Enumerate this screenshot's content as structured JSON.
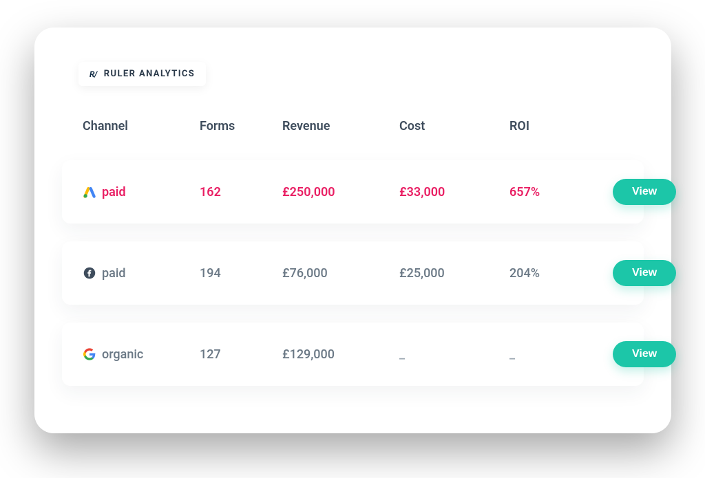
{
  "brand": {
    "mark": "R/",
    "name": "RULER ANALYTICS"
  },
  "headers": {
    "channel": "Channel",
    "forms": "Forms",
    "revenue": "Revenue",
    "cost": "Cost",
    "roi": "ROI"
  },
  "rows": [
    {
      "icon": "google-ads-icon",
      "channel": "paid",
      "forms": "162",
      "revenue": "£250,000",
      "cost": "£33,000",
      "roi": "657%",
      "highlight": true
    },
    {
      "icon": "facebook-icon",
      "channel": "paid",
      "forms": "194",
      "revenue": "£76,000",
      "cost": "£25,000",
      "roi": "204%",
      "highlight": false
    },
    {
      "icon": "google-icon",
      "channel": "organic",
      "forms": "127",
      "revenue": "£129,000",
      "cost": "_",
      "roi": "_",
      "highlight": false
    }
  ],
  "buttons": {
    "view": "View"
  },
  "colors": {
    "accent": "#1cc6a8",
    "highlight": "#e91e63",
    "text_primary": "#3e4c5c",
    "text_secondary": "#6a7885"
  }
}
